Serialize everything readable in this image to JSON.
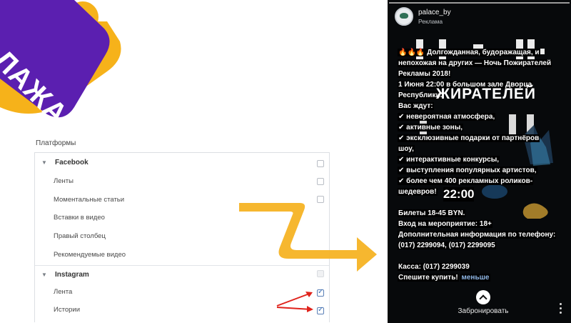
{
  "logo": {
    "text": "ЛАЖА"
  },
  "platforms": {
    "title": "Платформы",
    "groups": [
      {
        "name": "Facebook",
        "items": [
          "Ленты",
          "Моментальные статьи",
          "Вставки в видео",
          "Правый столбец",
          "Рекомендуемые видео"
        ]
      },
      {
        "name": "Instagram",
        "items": [
          "Лента",
          "Истории"
        ]
      }
    ]
  },
  "story": {
    "account": "palace_by",
    "subtitle": "Реклама",
    "lines": [
      "🔥🔥🔥 Долгожданная, будоражащая, и",
      "непохожая на других — Ночь Пожирателей",
      "Рекламы 2018!",
      "1 Июня 22:00 в большом зале Дворца",
      "Республики.",
      "Вас ждут:",
      "✔ невероятная атмосфера,",
      "✔ активные зоны,",
      "✔ эксклюзивные подарки от партнёров",
      "шоу,",
      "✔ интерактивные конкурсы,",
      "✔ выступления популярных артистов,",
      "✔ более чем 400 рекламных роликов-",
      "шедевров!",
      "",
      "Билеты 18-45 BYN.",
      "Вход на мероприятие: 18+",
      "Дополнительная информация по телефону:",
      "(017) 2299094, (017) 2299095",
      "",
      "Касса: (017) 2299039",
      "Спешите купить!"
    ],
    "more": "меньше",
    "poster_words": [
      "ЖИРАТЕЛЕЙ",
      "22:00"
    ],
    "cta": "Забронировать"
  },
  "colors": {
    "logo_purple": "#5b1fb0",
    "logo_orange": "#f6b21a",
    "arrow_yellow": "#f5b324",
    "annotation_red": "#e0231c"
  }
}
